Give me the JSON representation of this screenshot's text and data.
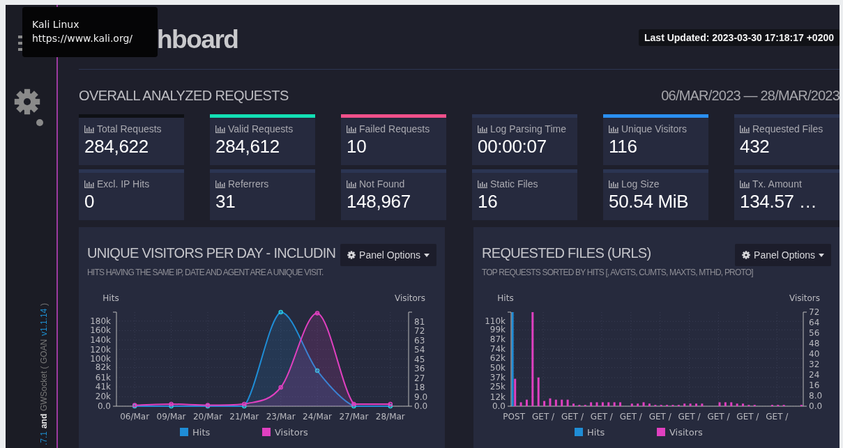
{
  "tooltip": {
    "title": "Kali Linux",
    "url": "https://www.kali.org/"
  },
  "sidebar": {
    "footer": [
      {
        "text": ".7.1",
        "kind": "link"
      },
      {
        "text": "and",
        "kind": "strong"
      },
      {
        "text": "GWSocket ( GOAN",
        "kind": "plain"
      },
      {
        "text": "v1.1.14",
        "kind": "link"
      },
      {
        "text": ")",
        "kind": "plain"
      }
    ]
  },
  "header": {
    "logo": "hboard",
    "last_updated": "Last Updated: 2023-03-30 17:18:17 +0200"
  },
  "overview": {
    "title": "OVERALL ANALYZED REQUESTS",
    "date_range": "06/MAR/2023 — 28/MAR/2023",
    "cards": [
      {
        "label": "Total Requests",
        "value": "284,622",
        "color": "#0e1014"
      },
      {
        "label": "Valid Requests",
        "value": "284,612",
        "color": "#12e0b4"
      },
      {
        "label": "Failed Requests",
        "value": "10",
        "color": "#f0508a"
      },
      {
        "label": "Log Parsing Time",
        "value": "00:00:07",
        "color": "#2b3553"
      },
      {
        "label": "Unique Visitors",
        "value": "116",
        "color": "#2a8ff0"
      },
      {
        "label": "Requested Files",
        "value": "432",
        "color": "#2b3553"
      },
      {
        "label": "Excl. IP Hits",
        "value": "0",
        "color": "#2b3553"
      },
      {
        "label": "Referrers",
        "value": "31",
        "color": "#2b3553"
      },
      {
        "label": "Not Found",
        "value": "148,967",
        "color": "#2b3553"
      },
      {
        "label": "Static Files",
        "value": "16",
        "color": "#2b3553"
      },
      {
        "label": "Log Size",
        "value": "50.54 MiB",
        "color": "#2b3553"
      },
      {
        "label": "Tx. Amount",
        "value": "134.57 …",
        "color": "#2b3553"
      }
    ]
  },
  "panels": [
    {
      "title": "UNIQUE VISITORS PER DAY - INCLUDIN",
      "subtitle": "HITS HAVING THE SAME IP, DATE AND AGENT ARE A UNIQUE VISIT.",
      "options": "Panel Options",
      "chart_data": {
        "type": "area",
        "grid": true,
        "legend": "bottom",
        "ylabel": "Hits",
        "y2label": "Visitors",
        "categories": [
          "06/Mar",
          "09/Mar",
          "20/Mar",
          "21/Mar",
          "23/Mar",
          "24/Mar",
          "27/Mar",
          "28/Mar"
        ],
        "ylim": [
          0,
          199000
        ],
        "yticks": [
          {
            "value": 0,
            "label": "0.0"
          },
          {
            "value": 20000,
            "label": "20k"
          },
          {
            "value": 41000,
            "label": "41k"
          },
          {
            "value": 61000,
            "label": "61k"
          },
          {
            "value": 82000,
            "label": "82k"
          },
          {
            "value": 100000,
            "label": "100k"
          },
          {
            "value": 120000,
            "label": "120k"
          },
          {
            "value": 140000,
            "label": "140k"
          },
          {
            "value": 160000,
            "label": "160k"
          },
          {
            "value": 180000,
            "label": "180k"
          }
        ],
        "y2lim": [
          0,
          90
        ],
        "y2ticks": [
          {
            "value": 0,
            "label": "0.0"
          },
          {
            "value": 9,
            "label": "9.0"
          },
          {
            "value": 18,
            "label": "18"
          },
          {
            "value": 27,
            "label": "27"
          },
          {
            "value": 36,
            "label": "36"
          },
          {
            "value": 45,
            "label": "45"
          },
          {
            "value": 54,
            "label": "54"
          },
          {
            "value": 63,
            "label": "63"
          },
          {
            "value": 72,
            "label": "72"
          },
          {
            "value": 81,
            "label": "81"
          }
        ],
        "series": [
          {
            "name": "Hits",
            "color": "#1f8dd6",
            "marker": "o",
            "values": [
              0,
              0,
              0,
              0,
              199000,
              75000,
              0,
              0
            ]
          },
          {
            "name": "Visitors",
            "color": "#e040c0",
            "axis": "y2",
            "marker": "o",
            "values": [
              1,
              2,
              1,
              2,
              18,
              89,
              2,
              2
            ]
          }
        ]
      }
    },
    {
      "title": "REQUESTED FILES (URLS)",
      "subtitle": "TOP REQUESTS SORTED BY HITS [, AVGTS, CUMTS, MAXTS, MTHD, PROTO]",
      "options": "Panel Options",
      "chart_data": {
        "type": "bar",
        "grid": true,
        "legend": "bottom",
        "ylabel": "Hits",
        "y2label": "Visitors",
        "categories": [
          "POST",
          null,
          null,
          null,
          null,
          "GET /",
          null,
          null,
          null,
          null,
          "GET /",
          null,
          null,
          null,
          null,
          "GET /",
          null,
          null,
          null,
          null,
          "GET /",
          null,
          null,
          null,
          null,
          "GET /",
          null,
          null,
          null,
          null,
          "GET /",
          null,
          null,
          null,
          null,
          "GET /",
          null,
          null,
          null,
          null,
          "GET /",
          null,
          null,
          null,
          null,
          "GET /",
          null,
          null,
          null,
          null
        ],
        "ylim": [
          0,
          122000
        ],
        "yticks": [
          {
            "value": 0,
            "label": "0.0"
          },
          {
            "value": 12000,
            "label": "12k"
          },
          {
            "value": 25000,
            "label": "25k"
          },
          {
            "value": 37000,
            "label": "37k"
          },
          {
            "value": 50000,
            "label": "50k"
          },
          {
            "value": 62000,
            "label": "62k"
          },
          {
            "value": 74000,
            "label": "74k"
          },
          {
            "value": 87000,
            "label": "87k"
          },
          {
            "value": 99000,
            "label": "99k"
          },
          {
            "value": 110000,
            "label": "110k"
          }
        ],
        "y2lim": [
          0,
          72
        ],
        "y2ticks": [
          {
            "value": 0,
            "label": "0.0"
          },
          {
            "value": 8,
            "label": "8.0"
          },
          {
            "value": 16,
            "label": "16"
          },
          {
            "value": 24,
            "label": "24"
          },
          {
            "value": 32,
            "label": "32"
          },
          {
            "value": 40,
            "label": "40"
          },
          {
            "value": 48,
            "label": "48"
          },
          {
            "value": 56,
            "label": "56"
          },
          {
            "value": 64,
            "label": "64"
          },
          {
            "value": 72,
            "label": "72"
          }
        ],
        "series": [
          {
            "name": "Hits",
            "color": "#1f8dd6",
            "values": [
              122000,
              0,
              0,
              0,
              0,
              0,
              0,
              0,
              0,
              0,
              0,
              0,
              0,
              0,
              0,
              0,
              0,
              0,
              0,
              0,
              0,
              0,
              0,
              0,
              0,
              0,
              0,
              0,
              0,
              0,
              0,
              0,
              0,
              0,
              0,
              0,
              0,
              0,
              0,
              0,
              0,
              0,
              0,
              0,
              0,
              0,
              0,
              0,
              0,
              0
            ]
          },
          {
            "name": "Visitors",
            "color": "#e040c0",
            "axis": "y2",
            "values": [
              21,
              3,
              5,
              72,
              22,
              4,
              6,
              5,
              5,
              5,
              2,
              1,
              1,
              3,
              3,
              3,
              3,
              3,
              3,
              0,
              2,
              2,
              3,
              2,
              1,
              1,
              1,
              1,
              1,
              2,
              2,
              2,
              2,
              0,
              0,
              3,
              3,
              3,
              2,
              2,
              1,
              1,
              0,
              0,
              1,
              1,
              1,
              0,
              0,
              1
            ]
          }
        ]
      }
    }
  ]
}
